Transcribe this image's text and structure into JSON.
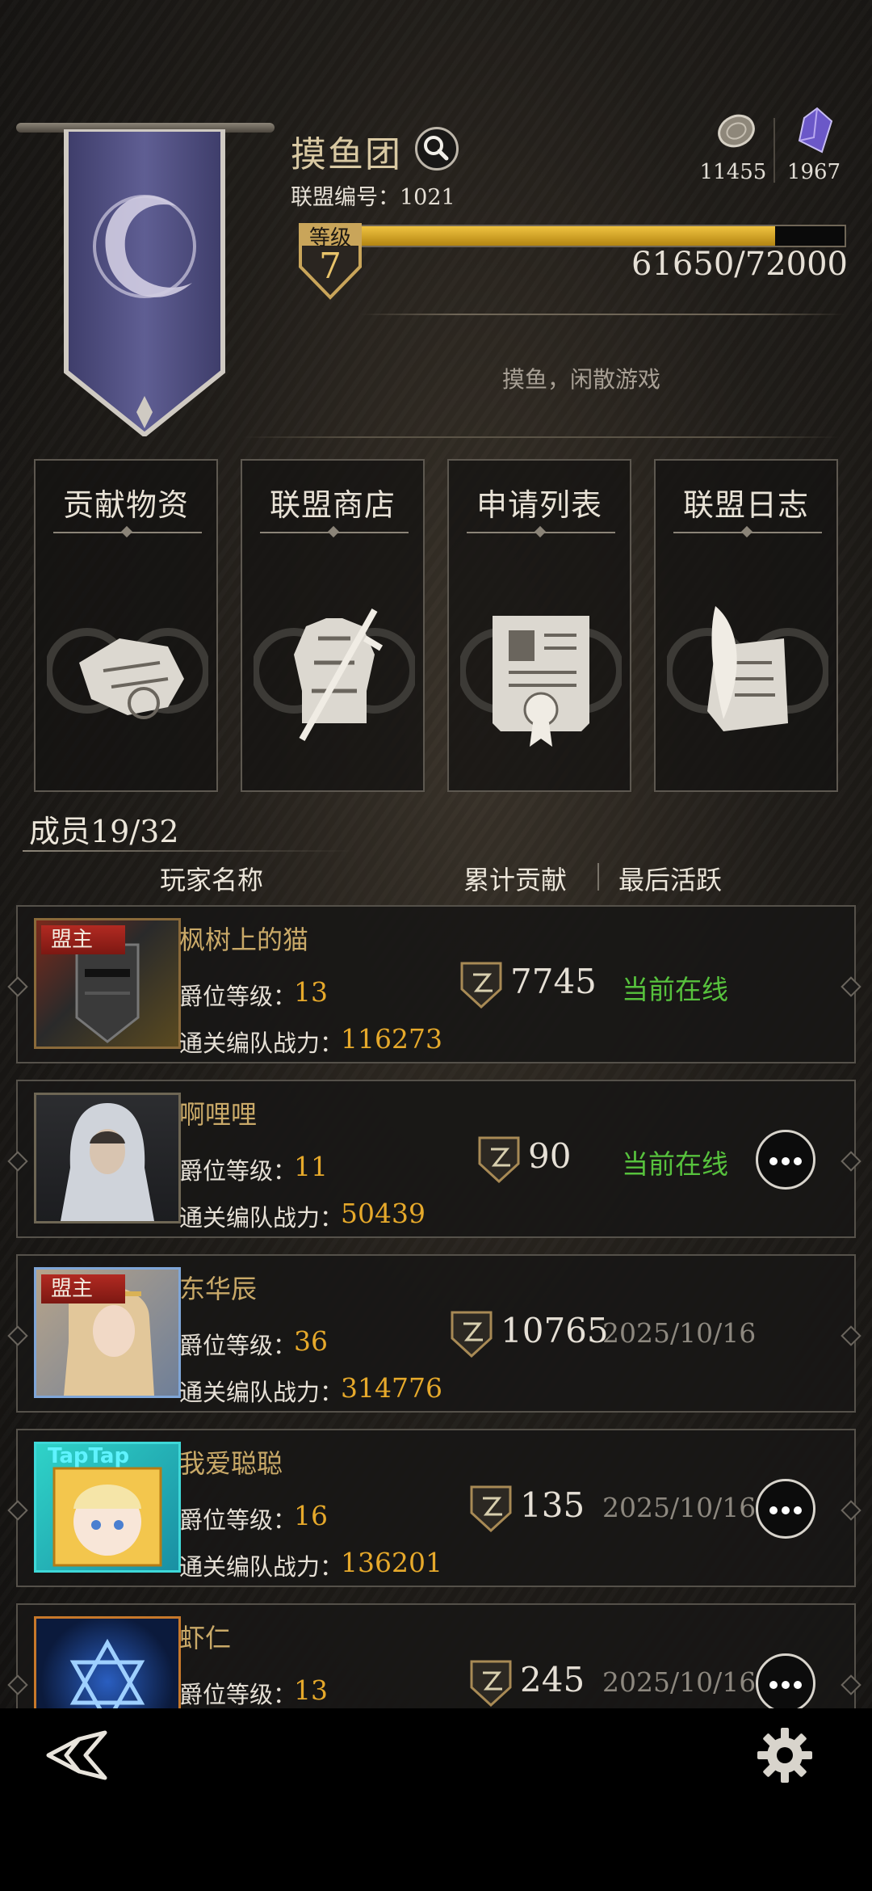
{
  "guild": {
    "name": "摸鱼团",
    "id_text": "联盟编号：1021",
    "level_label": "等级",
    "level": "7",
    "xp_text": "61650/72000",
    "xp_fraction": 0.8563,
    "motto": "摸鱼，闲散游戏"
  },
  "resources": {
    "coin": "11455",
    "crystal": "1967"
  },
  "actions": [
    {
      "label": "贡献物资",
      "icon": "scroll-bundle-icon"
    },
    {
      "label": "联盟商店",
      "icon": "armor-sword-icon"
    },
    {
      "label": "申请列表",
      "icon": "application-document-icon"
    },
    {
      "label": "联盟日志",
      "icon": "quill-page-icon"
    }
  ],
  "members": {
    "title": "成员19/32",
    "col_name": "玩家名称",
    "col_contrib": "累计贡献",
    "col_active": "最后活跃",
    "rank_label": "爵位等级：",
    "power_label": "通关编队战力：",
    "leader_tag": "盟主",
    "rows": [
      {
        "name": "枫树上的猫",
        "rank": "13",
        "power": "116273",
        "contribution": "7745",
        "last_active": "当前在线",
        "online": true,
        "leader": true,
        "more": false
      },
      {
        "name": "啊哩哩",
        "rank": "11",
        "power": "50439",
        "contribution": "90",
        "last_active": "当前在线",
        "online": true,
        "leader": false,
        "more": true
      },
      {
        "name": "东华辰",
        "rank": "36",
        "power": "314776",
        "contribution": "10765",
        "last_active": "2025/10/16",
        "online": false,
        "leader": true,
        "more": false
      },
      {
        "name": "我爱聪聪",
        "rank": "16",
        "power": "136201",
        "contribution": "135",
        "last_active": "2025/10/16",
        "online": false,
        "leader": false,
        "more": true
      },
      {
        "name": "虾仁",
        "rank": "13",
        "power": "",
        "contribution": "245",
        "last_active": "2025/10/16",
        "online": false,
        "leader": false,
        "more": true
      }
    ]
  },
  "avatar_badge": "TapTap",
  "colors": {
    "online": "#57c23d",
    "accent_gold": "#e6a92b",
    "leader_red": "#b22a22",
    "banner_purple": "#5b5a8e"
  }
}
